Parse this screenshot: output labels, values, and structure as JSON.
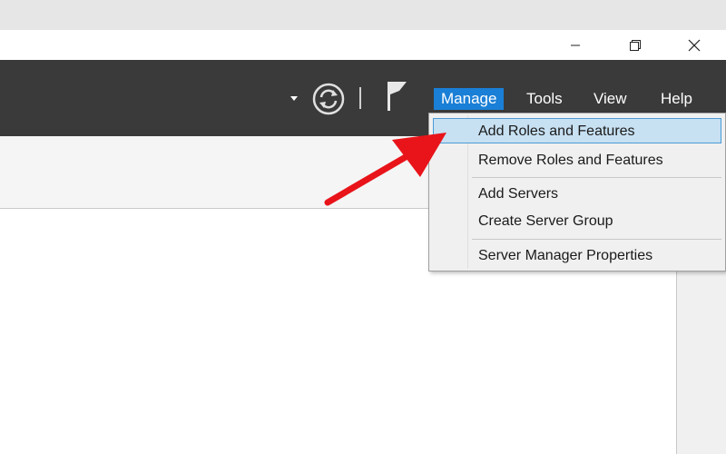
{
  "window_controls": {
    "minimize_icon": "minimize-icon",
    "restore_icon": "restore-icon",
    "close_icon": "close-icon"
  },
  "toolbar": {
    "dropdown_icon": "caret-down-icon",
    "refresh_icon": "refresh-icon",
    "notifications_icon": "flag-icon",
    "menus": [
      {
        "label": "Manage",
        "active": true
      },
      {
        "label": "Tools",
        "active": false
      },
      {
        "label": "View",
        "active": false
      },
      {
        "label": "Help",
        "active": false
      }
    ]
  },
  "manage_menu": {
    "items": [
      {
        "label": "Add Roles and Features",
        "highlighted": true
      },
      {
        "label": "Remove Roles and Features",
        "highlighted": false
      },
      {
        "label": "Add Servers",
        "highlighted": false
      },
      {
        "label": "Create Server Group",
        "highlighted": false
      },
      {
        "label": "Server Manager Properties",
        "highlighted": false
      }
    ]
  },
  "annotation": {
    "arrow_color": "#e8141a"
  },
  "colors": {
    "toolbar_bg": "#3a3a3a",
    "active_menu_bg": "#1a7fd6",
    "highlight_bg": "#c7e0f2"
  }
}
